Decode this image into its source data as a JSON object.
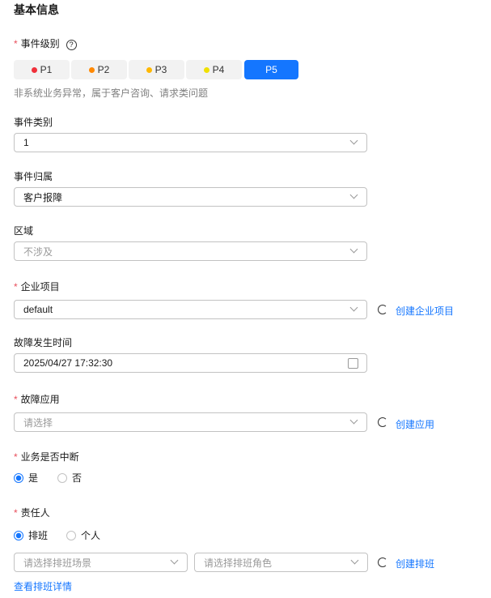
{
  "section_title": "基本信息",
  "level": {
    "label": "事件级别",
    "help": "?",
    "options": [
      {
        "label": "P1",
        "color": "#f0303a"
      },
      {
        "label": "P2",
        "color": "#ff8800"
      },
      {
        "label": "P3",
        "color": "#ffb800"
      },
      {
        "label": "P4",
        "color": "#f0e000"
      },
      {
        "label": "P5",
        "color": ""
      }
    ],
    "selected": "P5",
    "hint": "非系统业务异常，属于客户咨询、请求类问题"
  },
  "event_type": {
    "label": "事件类别",
    "value": "1"
  },
  "event_owner": {
    "label": "事件归属",
    "value": "客户报障"
  },
  "region": {
    "label": "区域",
    "value": "不涉及"
  },
  "project": {
    "label": "企业项目",
    "value": "default",
    "create": "创建企业项目"
  },
  "fault_time": {
    "label": "故障发生时间",
    "value": "2025/04/27 17:32:30"
  },
  "fault_app": {
    "label": "故障应用",
    "placeholder": "请选择",
    "create": "创建应用"
  },
  "interrupt": {
    "label": "业务是否中断",
    "options": [
      "是",
      "否"
    ],
    "selected": "是"
  },
  "owner": {
    "label": "责任人",
    "options": [
      "排班",
      "个人"
    ],
    "selected": "排班",
    "scene_placeholder": "请选择排班场景",
    "role_placeholder": "请选择排班角色",
    "create": "创建排班",
    "details": "查看排班详情"
  }
}
